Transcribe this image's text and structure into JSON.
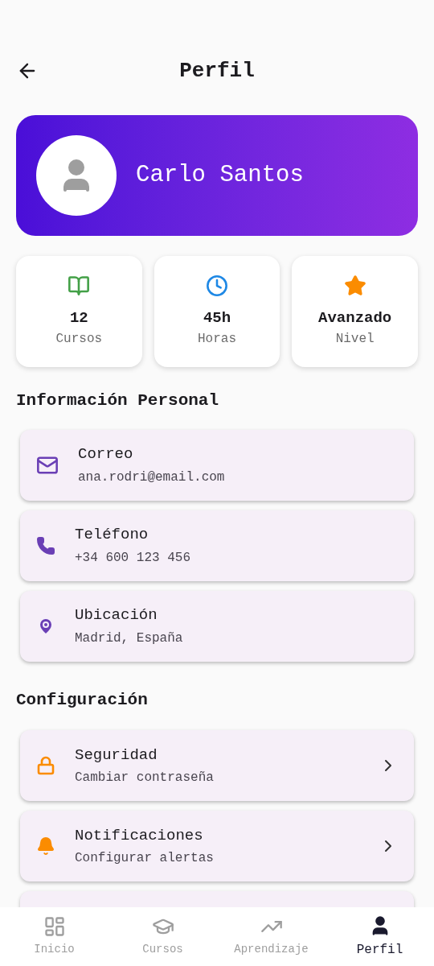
{
  "header": {
    "title": "Perfil"
  },
  "profile": {
    "name": "Carlo Santos"
  },
  "stats": [
    {
      "value": "12",
      "label": "Cursos"
    },
    {
      "value": "45h",
      "label": "Horas"
    },
    {
      "value": "Avanzado",
      "label": "Nivel"
    }
  ],
  "personal_info": {
    "title": "Información Personal",
    "items": [
      {
        "label": "Correo",
        "value": "ana.rodri@email.com"
      },
      {
        "label": "Teléfono",
        "value": "+34 600 123 456"
      },
      {
        "label": "Ubicación",
        "value": "Madrid, España"
      }
    ]
  },
  "settings": {
    "title": "Configuración",
    "items": [
      {
        "label": "Seguridad",
        "value": "Cambiar contraseña"
      },
      {
        "label": "Notificaciones",
        "value": "Configurar alertas"
      }
    ]
  },
  "bottom_nav": [
    {
      "label": "Inicio",
      "selected": false
    },
    {
      "label": "Cursos",
      "selected": false
    },
    {
      "label": "Aprendizaje",
      "selected": false
    },
    {
      "label": "Perfil",
      "selected": true
    }
  ]
}
